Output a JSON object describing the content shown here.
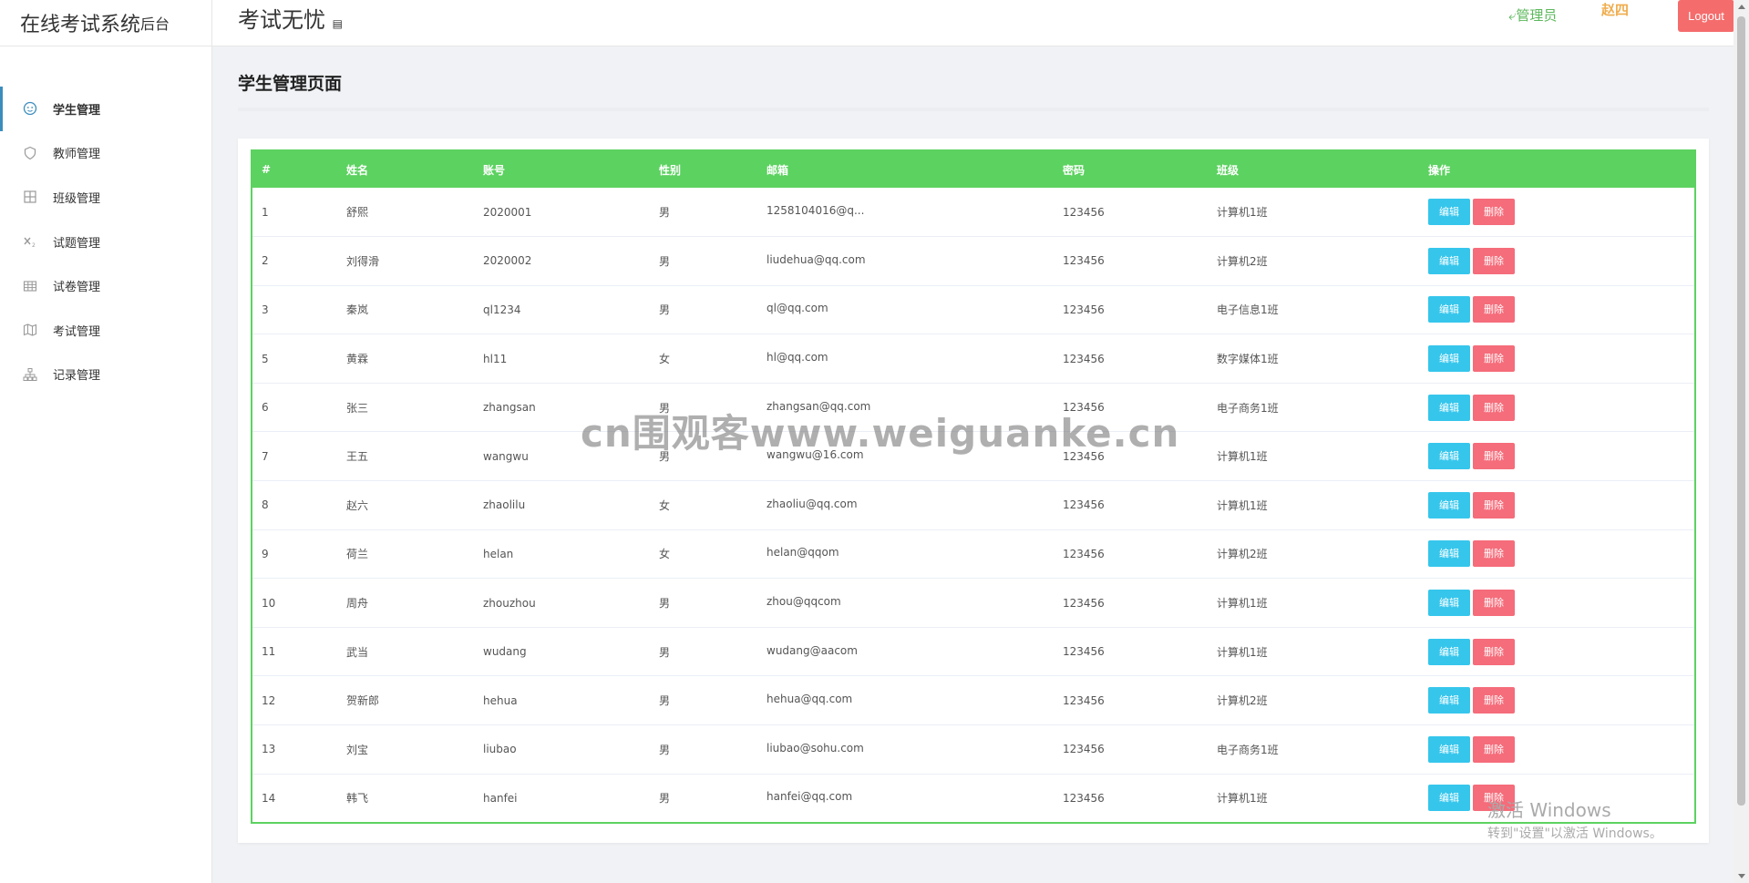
{
  "brand": {
    "title": "在线考试系统",
    "suffix": "后台"
  },
  "header": {
    "app_title": "考试无忧",
    "admin_label": "管理员",
    "user_name": "赵四",
    "logout_label": "Logout"
  },
  "sidebar": {
    "items": [
      {
        "label": "学生管理",
        "icon": "face-icon",
        "active": true
      },
      {
        "label": "教师管理",
        "icon": "shield-icon"
      },
      {
        "label": "班级管理",
        "icon": "grid-icon"
      },
      {
        "label": "试题管理",
        "icon": "formula-icon"
      },
      {
        "label": "试卷管理",
        "icon": "table-icon"
      },
      {
        "label": "考试管理",
        "icon": "map-icon"
      },
      {
        "label": "记录管理",
        "icon": "org-chart-icon"
      }
    ]
  },
  "page": {
    "title": "学生管理页面"
  },
  "table": {
    "columns": [
      "#",
      "姓名",
      "账号",
      "性别",
      "邮箱",
      "密码",
      "班级",
      "操作"
    ],
    "edit_label": "编辑",
    "delete_label": "删除",
    "rows": [
      [
        "1",
        "舒熙",
        "2020001",
        "男",
        "1258104016@q...",
        "123456",
        "计算机1班"
      ],
      [
        "2",
        "刘得滑",
        "2020002",
        "男",
        "liudehua@qq.com",
        "123456",
        "计算机2班"
      ],
      [
        "3",
        "秦岚",
        "ql1234",
        "男",
        "ql@qq.com",
        "123456",
        "电子信息1班"
      ],
      [
        "5",
        "黄霖",
        "hl11",
        "女",
        "hl@qq.com",
        "123456",
        "数字媒体1班"
      ],
      [
        "6",
        "张三",
        "zhangsan",
        "男",
        "zhangsan@qq.com",
        "123456",
        "电子商务1班"
      ],
      [
        "7",
        "王五",
        "wangwu",
        "男",
        "wangwu@16.com",
        "123456",
        "计算机1班"
      ],
      [
        "8",
        "赵六",
        "zhaolilu",
        "女",
        "zhaoliu@qq.com",
        "123456",
        "计算机1班"
      ],
      [
        "9",
        "荷兰",
        "helan",
        "女",
        "helan@qqom",
        "123456",
        "计算机2班"
      ],
      [
        "10",
        "周舟",
        "zhouzhou",
        "男",
        "zhou@qqcom",
        "123456",
        "计算机1班"
      ],
      [
        "11",
        "武当",
        "wudang",
        "男",
        "wudang@aacom",
        "123456",
        "计算机1班"
      ],
      [
        "12",
        "贺新郎",
        "hehua",
        "男",
        "hehua@qq.com",
        "123456",
        "计算机2班"
      ],
      [
        "13",
        "刘宝",
        "liubao",
        "男",
        "liubao@sohu.com",
        "123456",
        "电子商务1班"
      ],
      [
        "14",
        "韩飞",
        "hanfei",
        "男",
        "hanfei@qq.com",
        "123456",
        "计算机1班"
      ]
    ]
  },
  "watermark": "cn围观客www.weiguanke.cn",
  "windows_activation": {
    "line1": "激活 Windows",
    "line2": "转到\"设置\"以激活 Windows。"
  },
  "colors": {
    "header_green": "#5cd260",
    "edit_blue": "#36c6ec",
    "delete_red": "#f56c7a",
    "logout_red": "#f56c6c",
    "admin_green": "#5cb85c",
    "user_orange": "#f0ad4e"
  }
}
